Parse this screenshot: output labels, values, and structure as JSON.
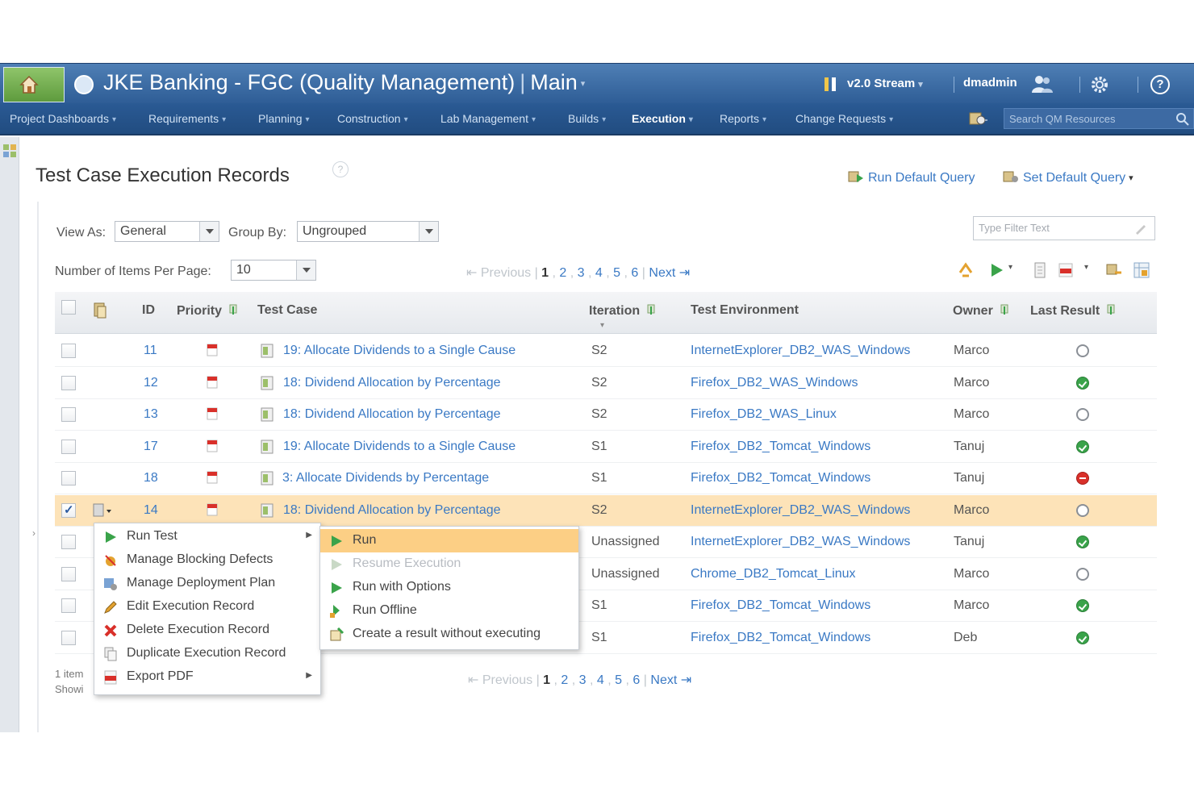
{
  "header": {
    "app_title": "JKE Banking - FGC (Quality Management)",
    "area": "Main",
    "stream": "v2.0 Stream",
    "user": "dmadmin"
  },
  "nav": {
    "items": [
      "Project Dashboards",
      "Requirements",
      "Planning",
      "Construction",
      "Lab Management",
      "Builds",
      "Execution",
      "Reports",
      "Change Requests"
    ],
    "active": "Execution",
    "search_placeholder": "Search QM Resources"
  },
  "page": {
    "title": "Test Case Execution Records",
    "run_default_query": "Run Default Query",
    "set_default_query": "Set Default Query",
    "view_as_label": "View As:",
    "view_as_value": "General",
    "group_by_label": "Group By:",
    "group_by_value": "Ungrouped",
    "filter_placeholder": "Type Filter Text",
    "items_per_page_label": "Number of Items Per Page:",
    "items_per_page_value": "10"
  },
  "pager": {
    "previous": "Previous",
    "pages": [
      "1",
      "2",
      "3",
      "4",
      "5",
      "6"
    ],
    "current": "1",
    "next": "Next"
  },
  "table": {
    "columns": [
      "ID",
      "Priority",
      "Test Case",
      "Iteration",
      "Test Environment",
      "Owner",
      "Last Result"
    ],
    "rows": [
      {
        "id": "11",
        "test_case": "19: Allocate Dividends to a Single Cause",
        "iteration": "S2",
        "environment": "InternetExplorer_DB2_WAS_Windows",
        "owner": "Marco",
        "result": "none",
        "checked": false
      },
      {
        "id": "12",
        "test_case": "18: Dividend Allocation by Percentage",
        "iteration": "S2",
        "environment": "Firefox_DB2_WAS_Windows",
        "owner": "Marco",
        "result": "pass",
        "checked": false
      },
      {
        "id": "13",
        "test_case": "18: Dividend Allocation by Percentage",
        "iteration": "S2",
        "environment": "Firefox_DB2_WAS_Linux",
        "owner": "Marco",
        "result": "none",
        "checked": false
      },
      {
        "id": "17",
        "test_case": "19: Allocate Dividends to a Single Cause",
        "iteration": "S1",
        "environment": "Firefox_DB2_Tomcat_Windows",
        "owner": "Tanuj",
        "result": "pass",
        "checked": false
      },
      {
        "id": "18",
        "test_case": "3: Allocate Dividends by Percentage",
        "iteration": "S1",
        "environment": "Firefox_DB2_Tomcat_Windows",
        "owner": "Tanuj",
        "result": "fail",
        "checked": false
      },
      {
        "id": "14",
        "test_case": "18: Dividend Allocation by Percentage",
        "iteration": "S2",
        "environment": "InternetExplorer_DB2_WAS_Windows",
        "owner": "Marco",
        "result": "none",
        "checked": true
      },
      {
        "id": "",
        "test_case": "",
        "iteration": "Unassigned",
        "environment": "InternetExplorer_DB2_WAS_Windows",
        "owner": "Tanuj",
        "result": "pass",
        "checked": false
      },
      {
        "id": "",
        "test_case": "",
        "iteration": "Unassigned",
        "environment": "Chrome_DB2_Tomcat_Linux",
        "owner": "Marco",
        "result": "none",
        "checked": false
      },
      {
        "id": "",
        "test_case": "",
        "iteration": "S1",
        "environment": "Firefox_DB2_Tomcat_Windows",
        "owner": "Marco",
        "result": "pass",
        "checked": false
      },
      {
        "id": "",
        "test_case": "",
        "iteration": "S1",
        "environment": "Firefox_DB2_Tomcat_Windows",
        "owner": "Deb",
        "result": "pass",
        "checked": false
      }
    ]
  },
  "footer": {
    "line1": "1 item",
    "line2": "Showi"
  },
  "context_menu": {
    "items": [
      "Run Test",
      "Manage Blocking Defects",
      "Manage Deployment Plan",
      "Edit Execution Record",
      "Delete Execution Record",
      "Duplicate Execution Record",
      "Export PDF"
    ]
  },
  "submenu": {
    "items": [
      "Run",
      "Resume Execution",
      "Run with Options",
      "Run Offline",
      "Create a result without executing"
    ],
    "highlighted": "Run",
    "disabled": "Resume Execution"
  },
  "colors": {
    "banner": "#3b6aa4",
    "link": "#3a79c4",
    "selected_row": "#fde3b8",
    "menu_highlight": "#fccf85"
  }
}
